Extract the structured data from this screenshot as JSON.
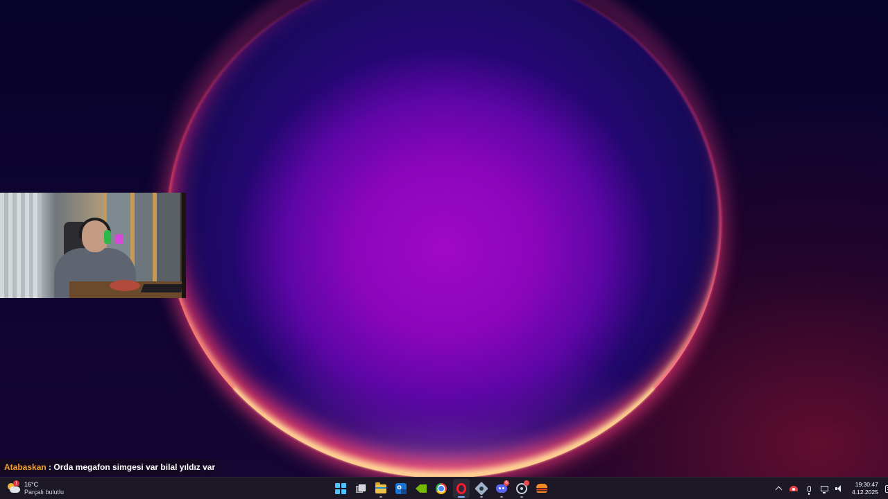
{
  "chat_overlay": {
    "username": "Atabaskan",
    "separator": " : ",
    "message": "Orda megafon simgesi var bilal yıldız var"
  },
  "taskbar": {
    "weather": {
      "icon": "partly-cloudy-icon",
      "badge": "1",
      "temperature": "16°C",
      "description": "Parçalı bulutlu"
    },
    "apps": [
      {
        "name": "start",
        "icon": "windows-logo-icon",
        "active": false
      },
      {
        "name": "task-view",
        "icon": "task-view-icon",
        "active": false
      },
      {
        "name": "file-explorer",
        "icon": "folder-icon",
        "active": false
      },
      {
        "name": "outlook",
        "icon": "outlook-icon",
        "active": false
      },
      {
        "name": "nvidia",
        "icon": "nvidia-icon",
        "active": false
      },
      {
        "name": "chrome",
        "icon": "chrome-icon",
        "active": false
      },
      {
        "name": "opera-gx",
        "icon": "opera-icon",
        "active": true
      },
      {
        "name": "settings-app",
        "icon": "gear-icon",
        "active": false
      },
      {
        "name": "discord",
        "icon": "discord-icon",
        "active": false,
        "badge": "6"
      },
      {
        "name": "steam",
        "icon": "steam-icon",
        "active": false,
        "badge": ""
      },
      {
        "name": "game-app",
        "icon": "burger-icon",
        "active": false
      }
    ],
    "tray": {
      "icons": [
        "chevron-up-icon",
        "gauge-icon",
        "microphone-icon",
        "monitor-icon",
        "speaker-icon"
      ],
      "time": "19:30:47",
      "date": "4.12.2025",
      "notification_icon": "notification-icon"
    }
  },
  "colors": {
    "username": "#f6a02b",
    "taskbar_bg": "#1c1826",
    "accent": "#4cc2ff"
  }
}
